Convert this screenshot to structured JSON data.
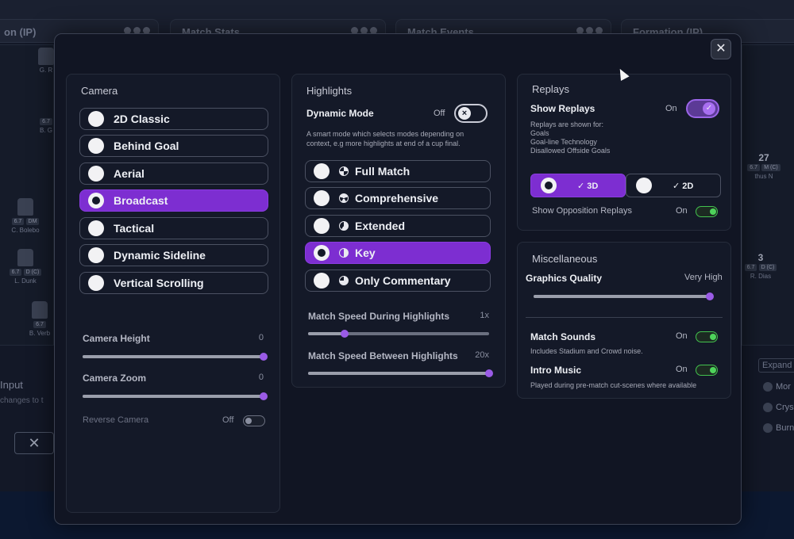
{
  "background": {
    "panels": [
      "on (IP)",
      "Match Stats",
      "Match Events",
      "Formation (IP)"
    ],
    "players_left": [
      {
        "name": "G. R",
        "rating": "6.7"
      },
      {
        "name": "B. G",
        "rating": "6.7"
      },
      {
        "name": "C. Bolebo",
        "rating": "6.7",
        "badge": "DM"
      },
      {
        "name": "L. Dunk",
        "rating": "6.7",
        "badge": "D (C)"
      },
      {
        "name": "B. Verb",
        "rating": "6.7"
      }
    ],
    "players_right": [
      {
        "name": "thus N",
        "rating": "6.7",
        "number": "27",
        "badge": "M (C)"
      },
      {
        "name": "R. Dias",
        "rating": "6.7",
        "number": "3",
        "badge": "D (C)"
      }
    ],
    "left_input": "Input",
    "left_sub": "changes to t",
    "right_expand": "Expand",
    "right_items": [
      "Mor",
      "Crys",
      "Burn"
    ],
    "bottom_glyph": "✕"
  },
  "modal": {
    "close_label": "✕",
    "camera": {
      "title": "Camera",
      "options": [
        {
          "label": "2D Classic",
          "selected": false
        },
        {
          "label": "Behind Goal",
          "selected": false
        },
        {
          "label": "Aerial",
          "selected": false
        },
        {
          "label": "Broadcast",
          "selected": true
        },
        {
          "label": "Tactical",
          "selected": false
        },
        {
          "label": "Dynamic Sideline",
          "selected": false
        },
        {
          "label": "Vertical Scrolling",
          "selected": false
        }
      ],
      "height_label": "Camera Height",
      "height_value": "0",
      "height_level": 1.0,
      "zoom_label": "Camera Zoom",
      "zoom_value": "0",
      "zoom_level": 1.0,
      "reverse_label": "Reverse Camera",
      "reverse_value": "Off"
    },
    "highlights": {
      "title": "Highlights",
      "dynamic_label": "Dynamic Mode",
      "dynamic_value": "Off",
      "dynamic_desc_1": "A smart mode which selects modes depending on",
      "dynamic_desc_2": "context, e.g more highlights at end of a cup final.",
      "options": [
        {
          "label": "Full Match",
          "icon": "full",
          "selected": false
        },
        {
          "label": "Comprehensive",
          "icon": "comp",
          "selected": false
        },
        {
          "label": "Extended",
          "icon": "ext",
          "selected": false
        },
        {
          "label": "Key",
          "icon": "key",
          "selected": true
        },
        {
          "label": "Only Commentary",
          "icon": "comm",
          "selected": false
        }
      ],
      "speed_during_label": "Match Speed During Highlights",
      "speed_during_value": "1x",
      "speed_during_level": 0.2,
      "speed_between_label": "Match Speed Between Highlights",
      "speed_between_value": "20x",
      "speed_between_level": 1.0
    },
    "replays": {
      "title": "Replays",
      "show_label": "Show Replays",
      "show_value": "On",
      "shown_for": "Replays are shown for:",
      "shown_items": [
        "Goals",
        "Goal-line Technology",
        "Disallowed Offside Goals"
      ],
      "mode_3d": "✓ 3D",
      "mode_2d": "✓ 2D",
      "opposition_label": "Show Opposition Replays",
      "opposition_value": "On"
    },
    "misc": {
      "title": "Miscellaneous",
      "graphics_label": "Graphics Quality",
      "graphics_value": "Very High",
      "graphics_level": 1.0,
      "sounds_label": "Match Sounds",
      "sounds_value": "On",
      "sounds_desc": "Includes Stadium and Crowd noise.",
      "intro_label": "Intro Music",
      "intro_value": "On",
      "intro_desc": "Played during pre-match cut-scenes where available"
    }
  },
  "colors": {
    "accent_purple": "#7d2ed1",
    "toggle_green": "#4ed35b",
    "slider_thumb": "#9a5be6"
  }
}
